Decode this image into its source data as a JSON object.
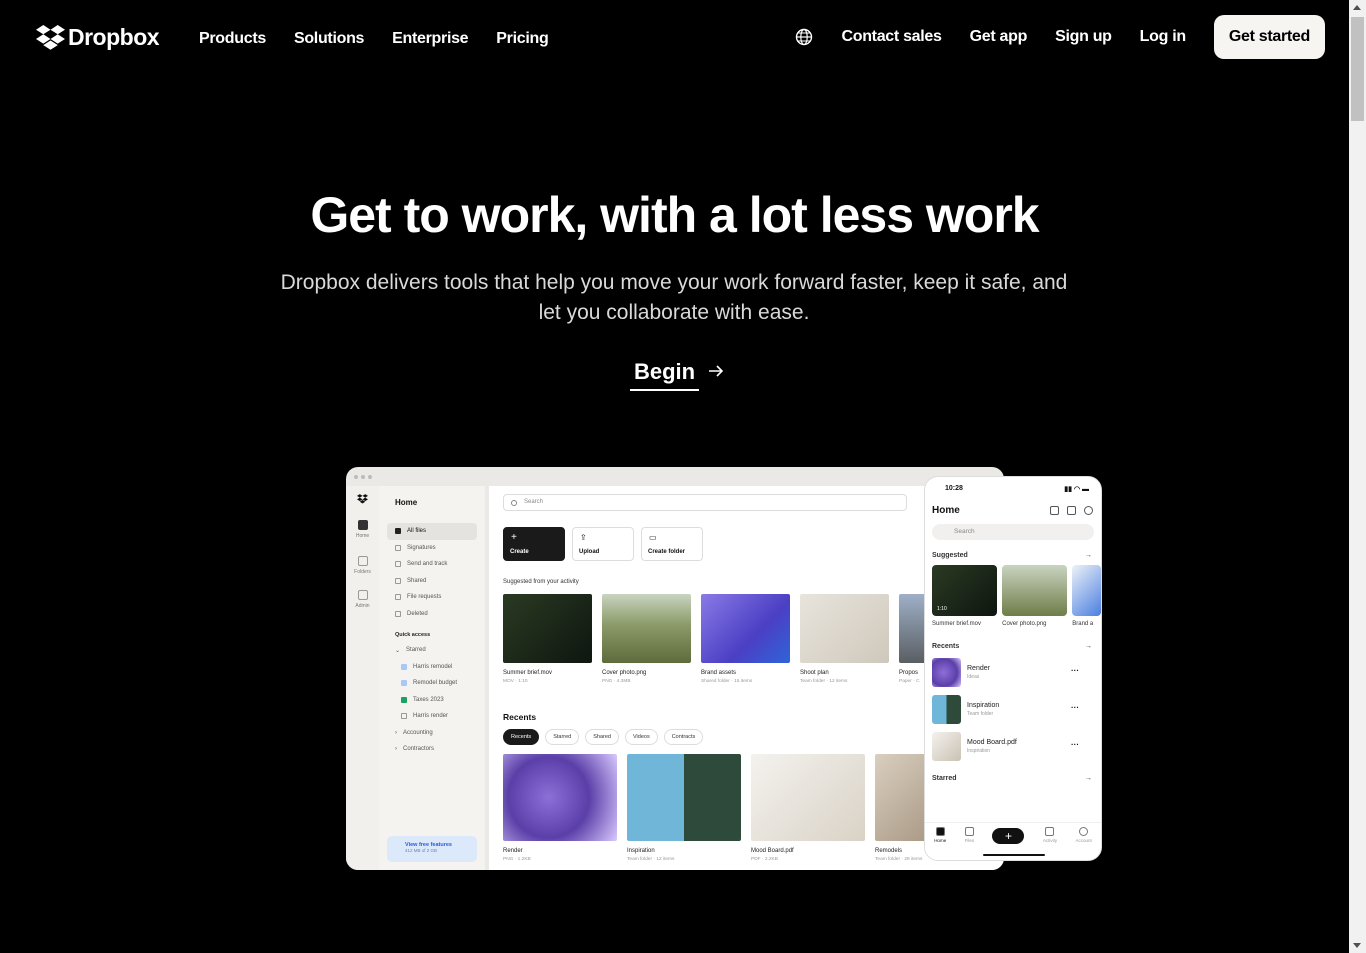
{
  "nav": {
    "logo": "Dropbox",
    "links": [
      "Products",
      "Solutions",
      "Enterprise",
      "Pricing"
    ],
    "contact": "Contact sales",
    "get_app": "Get app",
    "sign_up": "Sign up",
    "log_in": "Log in",
    "cta": "Get started"
  },
  "hero": {
    "title": "Get to work, with a lot less work",
    "subtitle": "Dropbox delivers tools that help you move your work forward faster, keep it safe, and let you collaborate with ease.",
    "begin": "Begin"
  },
  "colors": {
    "accent": "#0061fe",
    "bg": "#000000",
    "cta_bg": "#f7f5f2"
  },
  "desktop": {
    "rail": [
      "Home",
      "Folders",
      "Admin"
    ],
    "side_title": "Home",
    "side_items": [
      "All files",
      "Signatures",
      "Send and track",
      "Shared",
      "File requests",
      "Deleted"
    ],
    "quick_access": "Quick access",
    "starred": "Starred",
    "starred_items": [
      "Harris remodel",
      "Remodel budget",
      "Taxes 2023",
      "Harris render"
    ],
    "accounting": "Accounting",
    "contractors": "Contractors",
    "free_title": "View free features",
    "free_sub": "412 MB of 2 GB",
    "search": "Search",
    "actions": [
      "Create",
      "Upload",
      "Create folder"
    ],
    "suggested_label": "Suggested from your activity",
    "suggested": [
      {
        "name": "Summer brief.mov",
        "meta": "MOV · 1:10"
      },
      {
        "name": "Cover photo.png",
        "meta": "PNG · 4.3MB"
      },
      {
        "name": "Brand assets",
        "meta": "Shared folder · 15 items"
      },
      {
        "name": "Shoot plan",
        "meta": "Team folder · 12 items"
      },
      {
        "name": "Propos",
        "meta": "Paper · C"
      }
    ],
    "recents_title": "Recents",
    "chips": [
      "Recents",
      "Starred",
      "Shared",
      "Videos",
      "Contracts"
    ],
    "recents": [
      {
        "name": "Render",
        "meta": "PNG · 1.2KB"
      },
      {
        "name": "Inspiration",
        "meta": "Team folder · 12 items"
      },
      {
        "name": "Mood Board.pdf",
        "meta": "PDF · 2.2KB"
      },
      {
        "name": "Remodels",
        "meta": "Team folder · 28 items"
      }
    ]
  },
  "phone": {
    "time": "10:28",
    "title": "Home",
    "search": "Search",
    "suggested": "Suggested",
    "suggested_items": [
      "Summer brief.mov",
      "Cover photo.png",
      "Brand a"
    ],
    "badge": "1:10",
    "recents": "Recents",
    "recent_items": [
      {
        "name": "Render",
        "meta": "Ideas"
      },
      {
        "name": "Inspiration",
        "meta": "Team folder"
      },
      {
        "name": "Mood Board.pdf",
        "meta": "Inspiration"
      }
    ],
    "starred": "Starred",
    "tabs": [
      "Home",
      "Files",
      "Activity",
      "Account"
    ]
  }
}
